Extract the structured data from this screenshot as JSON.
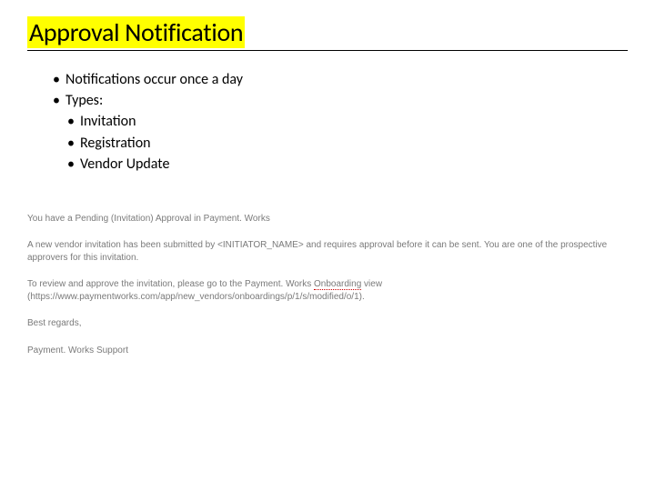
{
  "title": "Approval Notification",
  "bullets": {
    "item1": "Notifications occur once a day",
    "item2": "Types:",
    "sub1": "Invitation",
    "sub2": "Registration",
    "sub3": "Vendor Update"
  },
  "email": {
    "subject": "You have a Pending (Invitation) Approval in Payment. Works",
    "body": "A new vendor invitation has been submitted by <INITIATOR_NAME> and requires approval before it can be sent. You are one of the prospective approvers for this invitation.",
    "action_prefix": "To review and approve the invitation, please go to the Payment. Works ",
    "action_underlined": "Onboarding",
    "action_suffix": " view (",
    "url": "https://www.paymentworks.com/app/new_vendors/onboardings/p/1/s/modified/o/1",
    "action_close": ").",
    "signoff": "Best regards,",
    "signature": "Payment. Works Support"
  }
}
